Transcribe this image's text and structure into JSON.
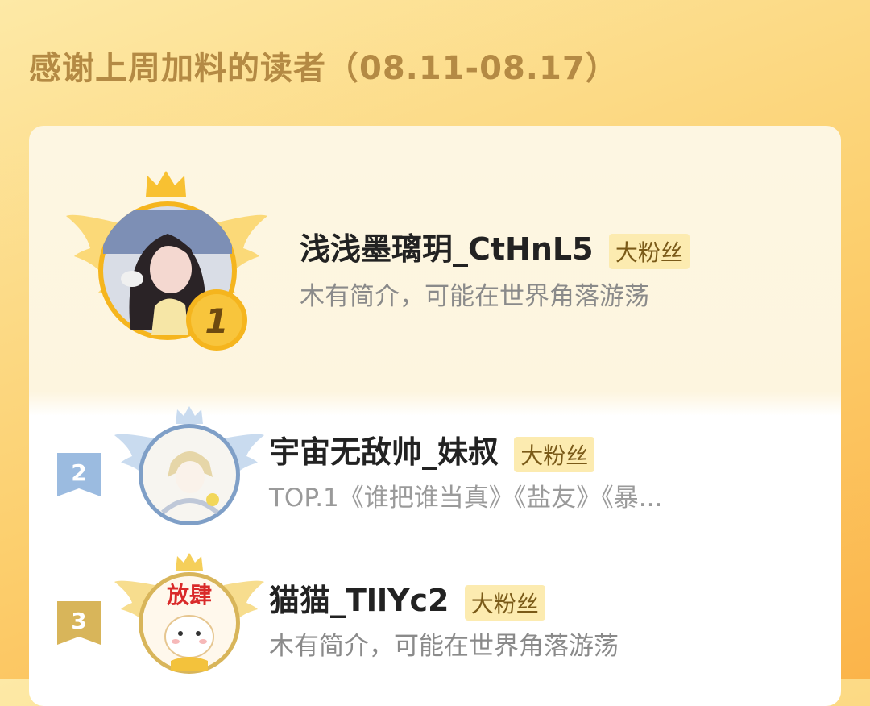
{
  "header": {
    "title": "感谢上周加料的读者（08.11-08.17）"
  },
  "readers": [
    {
      "rank": "1",
      "name": "浅浅墨璃玥_CtHnL5",
      "badge": "大粉丝",
      "bio": "木有简介，可能在世界角落游荡"
    },
    {
      "rank": "2",
      "name": "宇宙无敌帅_妹叔",
      "badge": "大粉丝",
      "bio": "TOP.1《谁把谁当真》《盐友》《暴..."
    },
    {
      "rank": "3",
      "name": "猫猫_TllYc2",
      "badge": "大粉丝",
      "bio": "木有简介，可能在世界角落游荡",
      "avatar_text": "放肆"
    }
  ],
  "colors": {
    "gold": "#f5b51e",
    "silver": "#8eb0d8",
    "bronze": "#d8b55a"
  },
  "icons": [
    "crown-icon",
    "wings-icon",
    "rank-medal-icon",
    "rank-flag-icon"
  ]
}
